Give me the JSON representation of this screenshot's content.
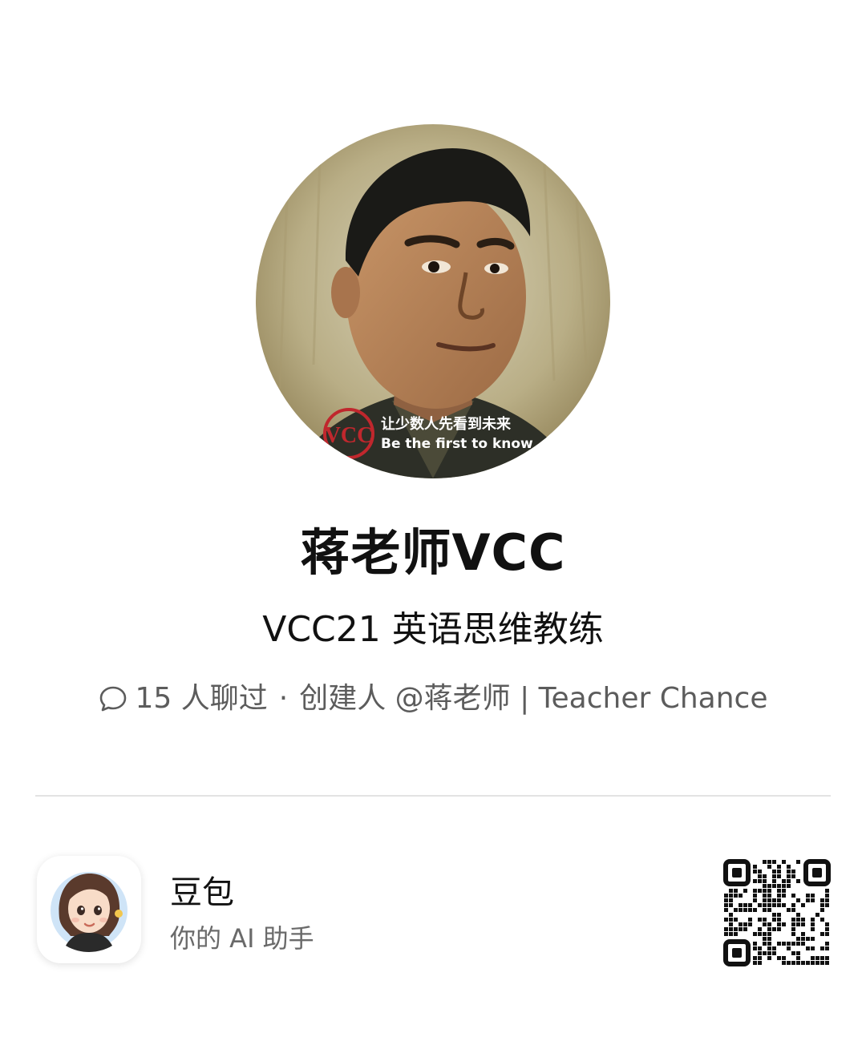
{
  "profile": {
    "name": "蒋老师VCC",
    "description": "VCC21 英语思维教练",
    "avatar": {
      "icon": "teacher-portrait-avatar",
      "badge_logo_text": "VCC",
      "badge_line1": "让少数人先看到未来",
      "badge_line2": "Be the first to know"
    }
  },
  "meta": {
    "chat_icon": "chat-bubble-icon",
    "chat_count": "15 人聊过",
    "separator": "·",
    "creator": "创建人 @蒋老师 | Teacher Chance"
  },
  "footer": {
    "app_name": "豆包",
    "app_slogan": "你的 AI 助手",
    "app_icon": "doubao-app-icon",
    "qr_icon": "qr-code-icon"
  },
  "colors": {
    "text_primary": "#111111",
    "text_secondary": "#5c5c5c",
    "divider": "#e3e3e3",
    "badge_red": "#c0272d"
  }
}
